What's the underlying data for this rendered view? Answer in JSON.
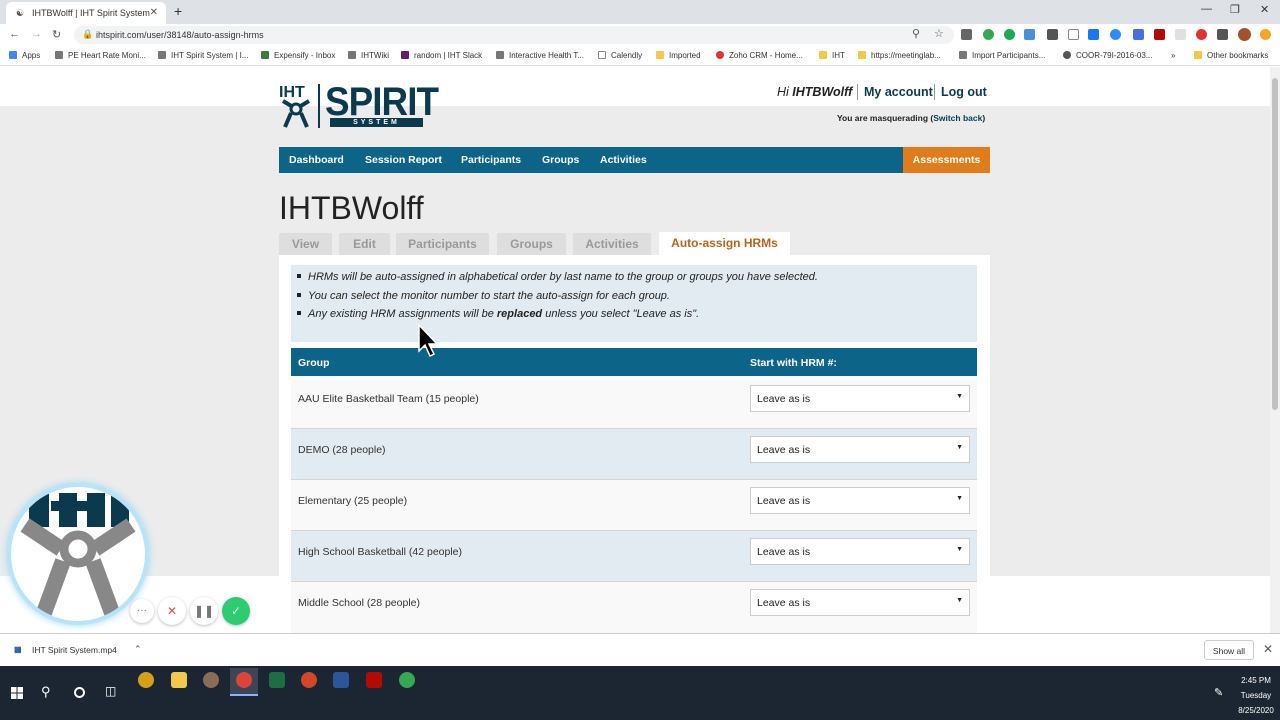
{
  "browser": {
    "tab_title": "IHTBWolff | IHT Spirit System",
    "url": "ihtspirit.com/user/38148/auto-assign-hrms",
    "bookmarks": [
      "Apps",
      "PE Heart Rate Moni...",
      "IHT Spirit System | I...",
      "Expensify - Inbox",
      "IHTWiki",
      "random | IHT Slack",
      "Interactive Health T...",
      "Calendly",
      "Imported",
      "Zoho CRM - Home...",
      "IHT",
      "https://meetinglab...",
      "Import Participants...",
      "COOR-79I-2016-03...",
      "Other bookmarks"
    ]
  },
  "header": {
    "logo_iht": "IHT",
    "logo_spirit": "SPIRIT",
    "logo_system": "SYSTEM",
    "greeting_prefix": "Hi",
    "username": "IHTBWolff",
    "my_account": "My account",
    "log_out": "Log out",
    "masquerade_text": "You are masquerading (",
    "switch_back": "Switch back",
    "masquerade_close": ")"
  },
  "nav": {
    "items": [
      "Dashboard",
      "Session Report",
      "Participants",
      "Groups",
      "Activities"
    ],
    "assessments": "Assessments"
  },
  "page": {
    "title": "IHTBWolff",
    "tabs": [
      "View",
      "Edit",
      "Participants",
      "Groups",
      "Activities",
      "Auto-assign HRMs"
    ],
    "active_tab": "Auto-assign HRMs",
    "notes": [
      "HRMs will be auto-assigned in alphabetical order by last name to the group or groups you have selected.",
      "You can select the monitor number to start the auto-assign for each group.",
      "Any existing HRM assignments will be "
    ],
    "note3_bold": "replaced",
    "note3_tail": " unless you select \"Leave as is\".",
    "table": {
      "headers": [
        "Group",
        "Start with HRM #:"
      ],
      "rows": [
        {
          "group": "AAU Elite Basketball Team (15 people)",
          "hrm": "Leave as is"
        },
        {
          "group": "DEMO (28 people)",
          "hrm": "Leave as is"
        },
        {
          "group": "Elementary (25 people)",
          "hrm": "Leave as is"
        },
        {
          "group": "High School Basketball (42 people)",
          "hrm": "Leave as is"
        },
        {
          "group": "Middle School (28 people)",
          "hrm": "Leave as is"
        }
      ]
    }
  },
  "download": {
    "filename": "IHT Spirit System.mp4",
    "show_all": "Show all"
  },
  "taskbar": {
    "time": "2:45 PM",
    "day": "Tuesday",
    "date": "8/25/2020"
  }
}
